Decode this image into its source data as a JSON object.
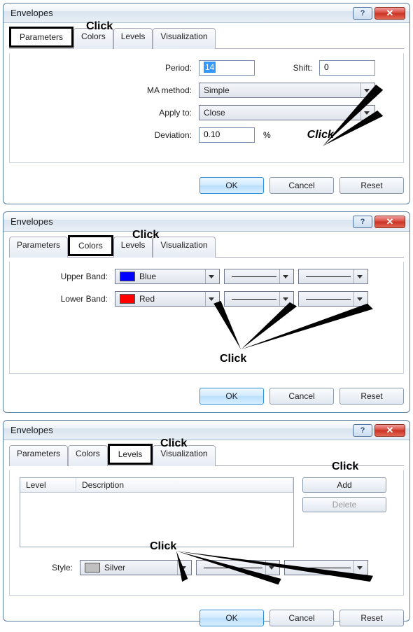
{
  "dialog1": {
    "title": "Envelopes",
    "tabs": [
      "Parameters",
      "Colors",
      "Levels",
      "Visualization"
    ],
    "activeTab": 0,
    "labels": {
      "period": "Period:",
      "shift": "Shift:",
      "ma": "MA method:",
      "apply": "Apply to:",
      "deviation": "Deviation:"
    },
    "values": {
      "period": "14",
      "shift": "0",
      "ma": "Simple",
      "apply": "Close",
      "deviation": "0.10",
      "percent": "%"
    },
    "buttons": {
      "ok": "OK",
      "cancel": "Cancel",
      "reset": "Reset"
    },
    "annotations": {
      "top": "Click",
      "right": "Click"
    }
  },
  "dialog2": {
    "title": "Envelopes",
    "tabs": [
      "Parameters",
      "Colors",
      "Levels",
      "Visualization"
    ],
    "activeTab": 1,
    "labels": {
      "upper": "Upper Band:",
      "lower": "Lower Band:"
    },
    "values": {
      "upperColorName": "Blue",
      "upperColorHex": "#0000ff",
      "lowerColorName": "Red",
      "lowerColorHex": "#ff0000"
    },
    "buttons": {
      "ok": "OK",
      "cancel": "Cancel",
      "reset": "Reset"
    },
    "annotations": {
      "top": "Click",
      "bottom": "Click"
    }
  },
  "dialog3": {
    "title": "Envelopes",
    "tabs": [
      "Parameters",
      "Colors",
      "Levels",
      "Visualization"
    ],
    "activeTab": 2,
    "list": {
      "col1": "Level",
      "col2": "Description"
    },
    "styleLabel": "Style:",
    "styleColorName": "Silver",
    "styleColorHex": "#c0c0c0",
    "sideButtons": {
      "add": "Add",
      "delete": "Delete"
    },
    "buttons": {
      "ok": "OK",
      "cancel": "Cancel",
      "reset": "Reset"
    },
    "annotations": {
      "top": "Click",
      "addTop": "Click",
      "bottom": "Click"
    }
  }
}
